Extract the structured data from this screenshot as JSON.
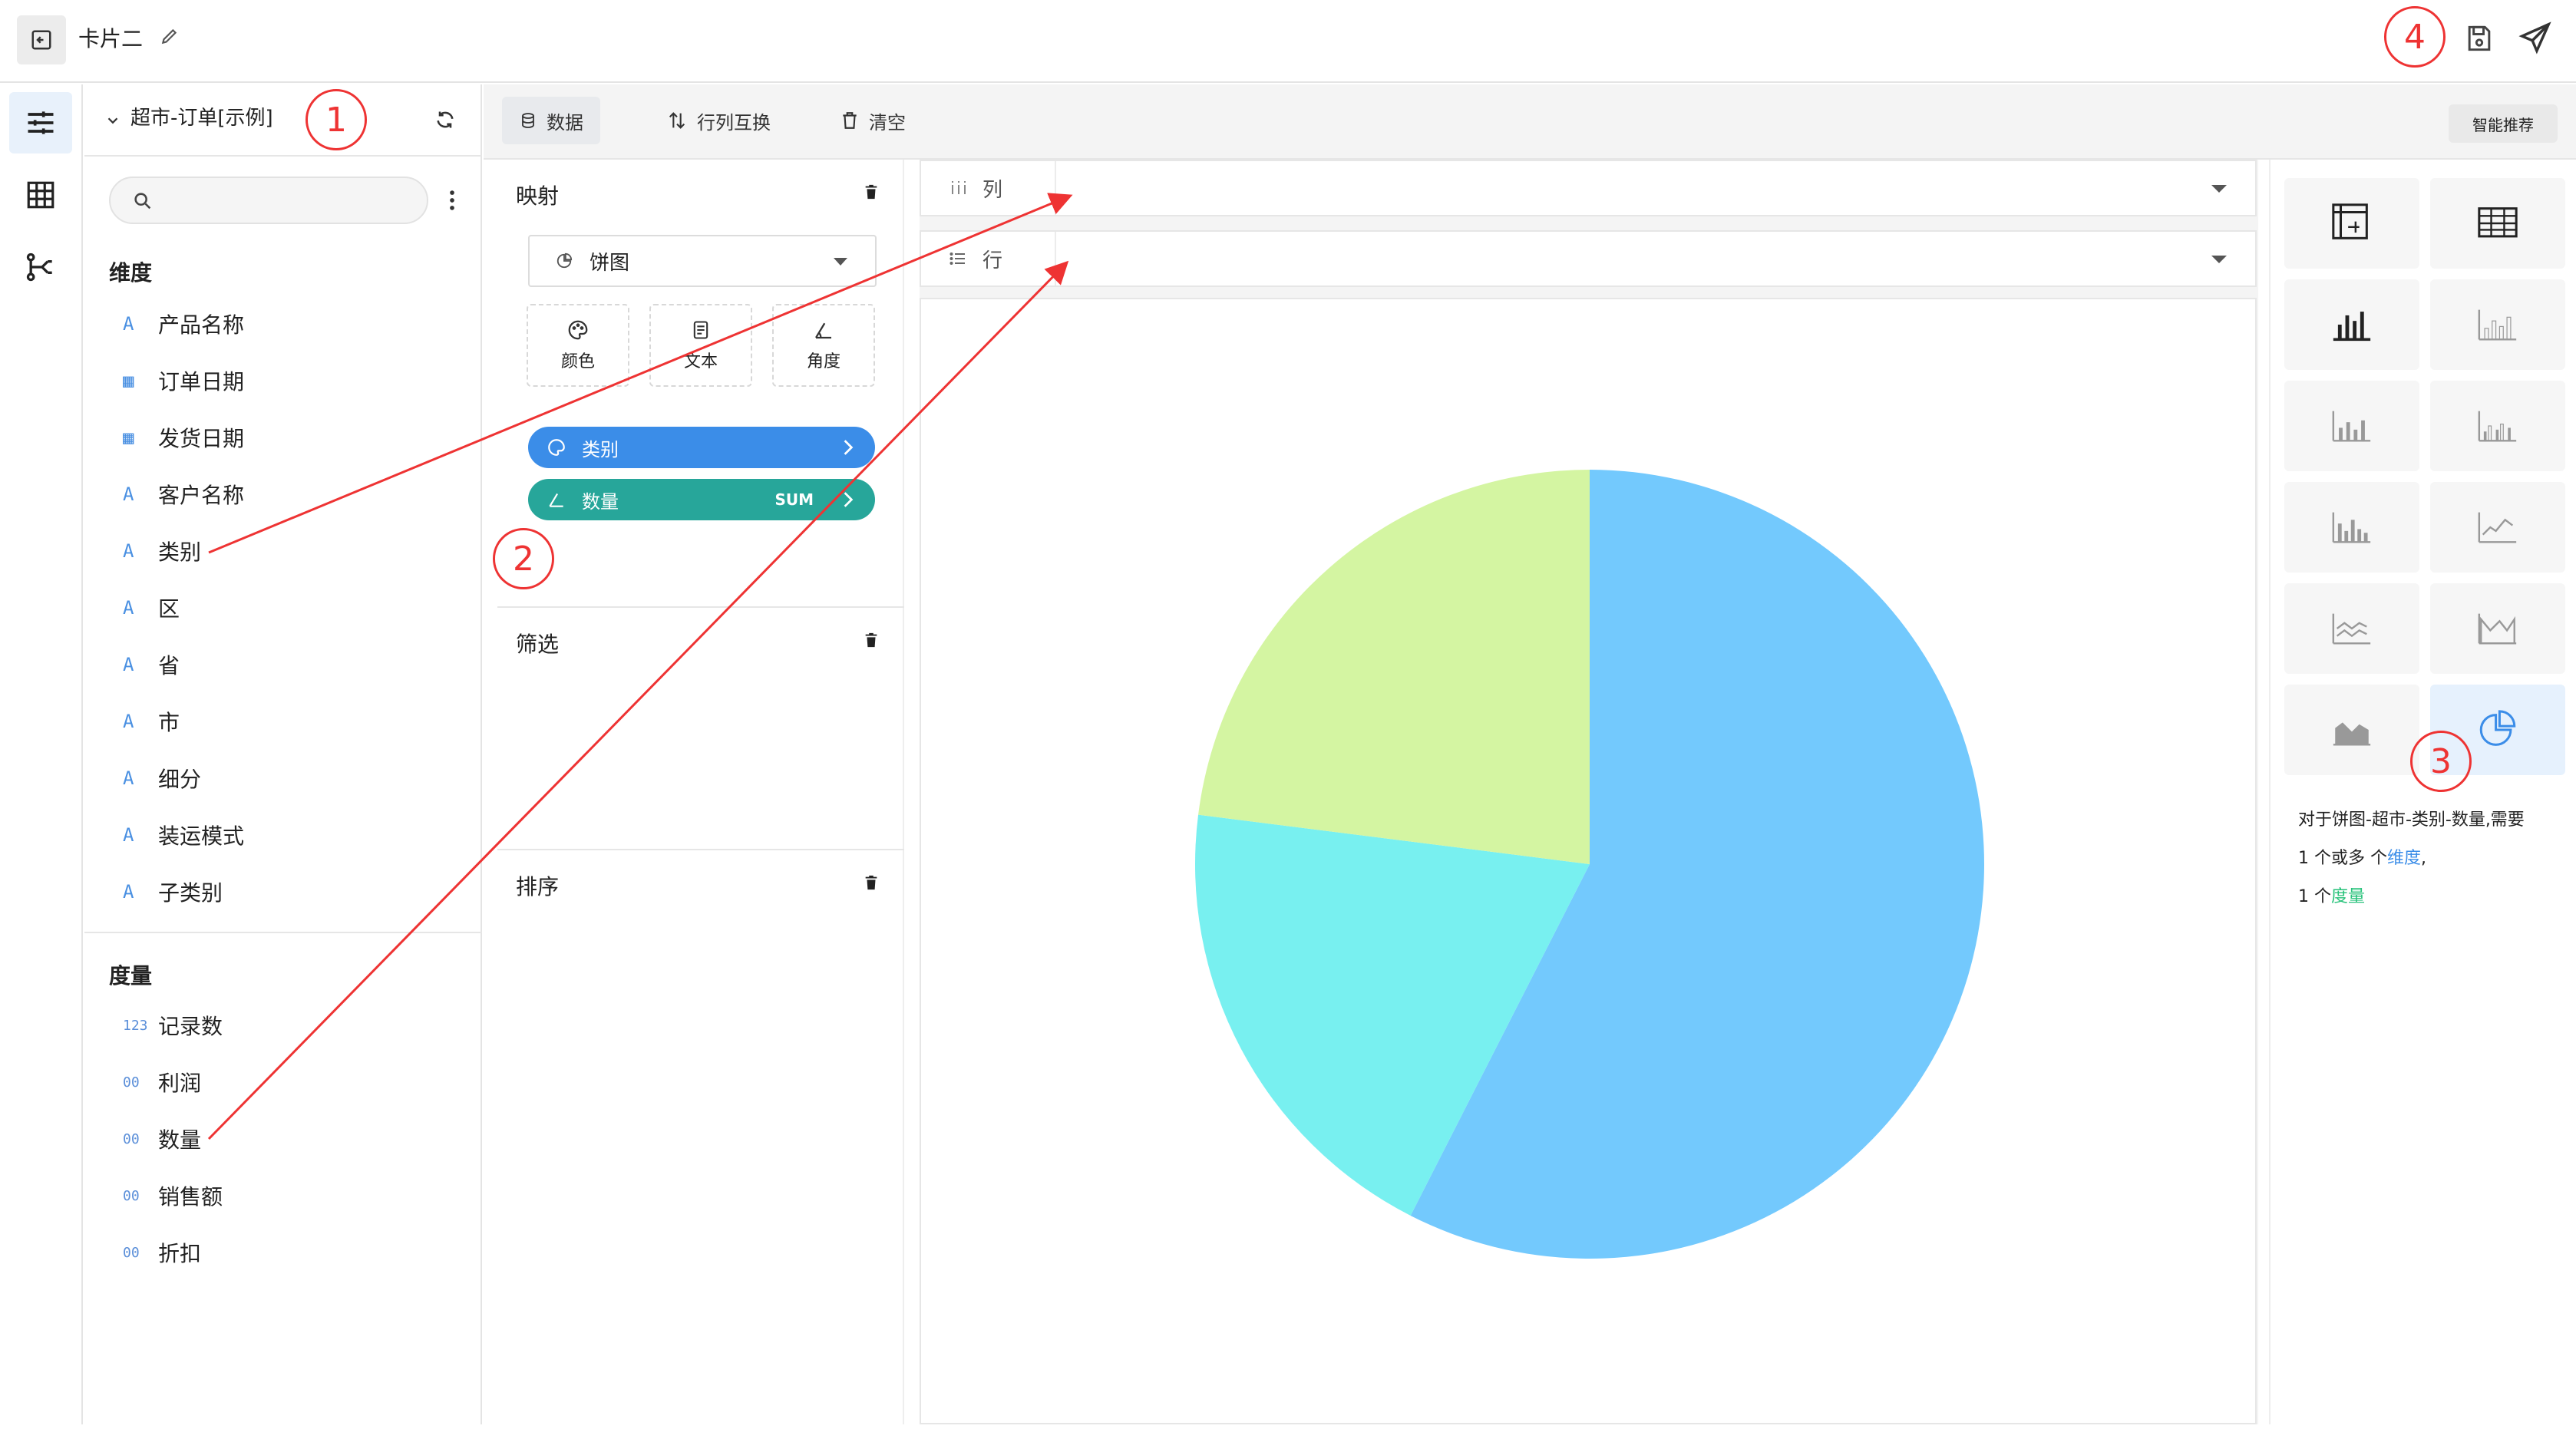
{
  "header": {
    "title": "卡片二"
  },
  "datasource": {
    "name": "超市-订单[示例]"
  },
  "search": {
    "placeholder": ""
  },
  "dimensions": {
    "title": "维度",
    "items": [
      {
        "label": "产品名称",
        "type": "A"
      },
      {
        "label": "订单日期",
        "type": "date"
      },
      {
        "label": "发货日期",
        "type": "date"
      },
      {
        "label": "客户名称",
        "type": "A"
      },
      {
        "label": "类别",
        "type": "A"
      },
      {
        "label": "区",
        "type": "A"
      },
      {
        "label": "省",
        "type": "A"
      },
      {
        "label": "市",
        "type": "A"
      },
      {
        "label": "细分",
        "type": "A"
      },
      {
        "label": "装运模式",
        "type": "A"
      },
      {
        "label": "子类别",
        "type": "A"
      }
    ]
  },
  "measures": {
    "title": "度量",
    "items": [
      {
        "label": "记录数",
        "type": "123"
      },
      {
        "label": "利润",
        "type": "00"
      },
      {
        "label": "数量",
        "type": "00"
      },
      {
        "label": "销售额",
        "type": "00"
      },
      {
        "label": "折扣",
        "type": "00"
      }
    ]
  },
  "toolbar": {
    "data": "数据",
    "swap": "行列互换",
    "clear": "清空",
    "smart": "智能推荐"
  },
  "mapping": {
    "title": "映射",
    "chart_type": "饼图",
    "encodings": [
      {
        "label": "颜色"
      },
      {
        "label": "文本"
      },
      {
        "label": "角度"
      }
    ],
    "pills": [
      {
        "label": "类别",
        "agg": "",
        "color": "#3b8de8"
      },
      {
        "label": "数量",
        "agg": "SUM",
        "color": "#27a69a"
      }
    ]
  },
  "filter": {
    "title": "筛选"
  },
  "sort": {
    "title": "排序"
  },
  "shelves": {
    "columns": "列",
    "rows": "行"
  },
  "hint": {
    "line1": "对于饼图-超市-类别-数量,需要",
    "line2a": "1 个或多 个",
    "line2b": "维度",
    "line2c": ",",
    "line3a": "1 个",
    "line3b": "度量"
  },
  "annotations": [
    "1",
    "2",
    "3",
    "4"
  ],
  "chart_data": {
    "type": "pie",
    "values": [
      57.5,
      19.5,
      23.0
    ],
    "colors": [
      "#73c9fd",
      "#78f0f0",
      "#d4f5a2"
    ]
  }
}
